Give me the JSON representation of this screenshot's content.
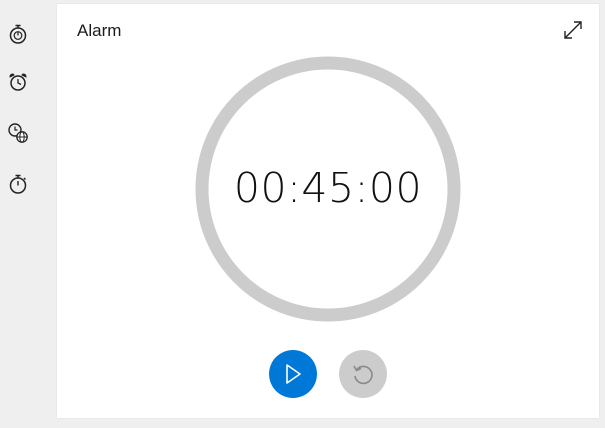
{
  "sidebar": {
    "items": [
      {
        "name": "timer",
        "icon": "timer-icon"
      },
      {
        "name": "alarm",
        "icon": "alarm-clock-icon"
      },
      {
        "name": "world-clock",
        "icon": "world-clock-icon"
      },
      {
        "name": "stopwatch",
        "icon": "stopwatch-icon"
      }
    ]
  },
  "card": {
    "title": "Alarm",
    "time": "00:45:00",
    "progress": 1.0
  },
  "controls": {
    "play_icon": "play-icon",
    "reset_icon": "reset-icon"
  },
  "colors": {
    "accent": "#0078d7",
    "ring": "#cccccc",
    "background": "#efefef",
    "card": "#ffffff"
  }
}
